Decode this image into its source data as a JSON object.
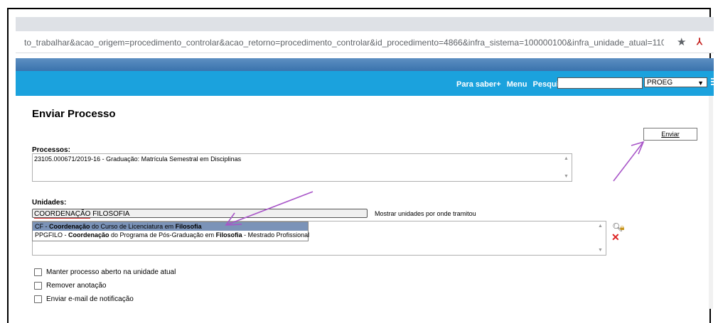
{
  "browser": {
    "url": "to_trabalhar&acao_origem=procedimento_controlar&acao_retorno=procedimento_controlar&id_procedimento=4866&infra_sistema=100000100&infra_unidade_atual=110000081&infra_hash=00b...",
    "star_icon": "★"
  },
  "nav": {
    "links": [
      "Para saber+",
      "Menu",
      "Pesquisa"
    ],
    "unit_selected": "PROEG"
  },
  "page": {
    "title": "Enviar Processo",
    "enviar_label": "Enviar"
  },
  "processos": {
    "label": "Processos:",
    "value": "23105.000671/2019-16 - Graduação: Matrícula Semestral em Disciplinas"
  },
  "unidades": {
    "label": "Unidades:",
    "input_value_prefix": "COORDENAÇÃO",
    "input_value_suffix": " FILOSOFIA",
    "mostrar_label": "Mostrar unidades por onde tramitou",
    "suggestions": [
      {
        "p1": "CF - ",
        "b1": "Coordenação",
        "p2": " do Curso de Licenciatura em ",
        "b2": "Filosofia",
        "p3": ""
      },
      {
        "p1": "PPGFILO - ",
        "b1": "Coordenação",
        "p2": " do Programa de Pós-Graduação em ",
        "b2": "Filosofia",
        "p3": " - Mestrado Profissional"
      }
    ]
  },
  "options": [
    "Manter processo aberto na unidade atual",
    "Remover anotação",
    "Enviar e-mail de notificação"
  ],
  "colors": {
    "navbar": "#1ba2dd",
    "annotation_arrow": "#a855c8",
    "selected_suggestion": "#7b93b8"
  }
}
